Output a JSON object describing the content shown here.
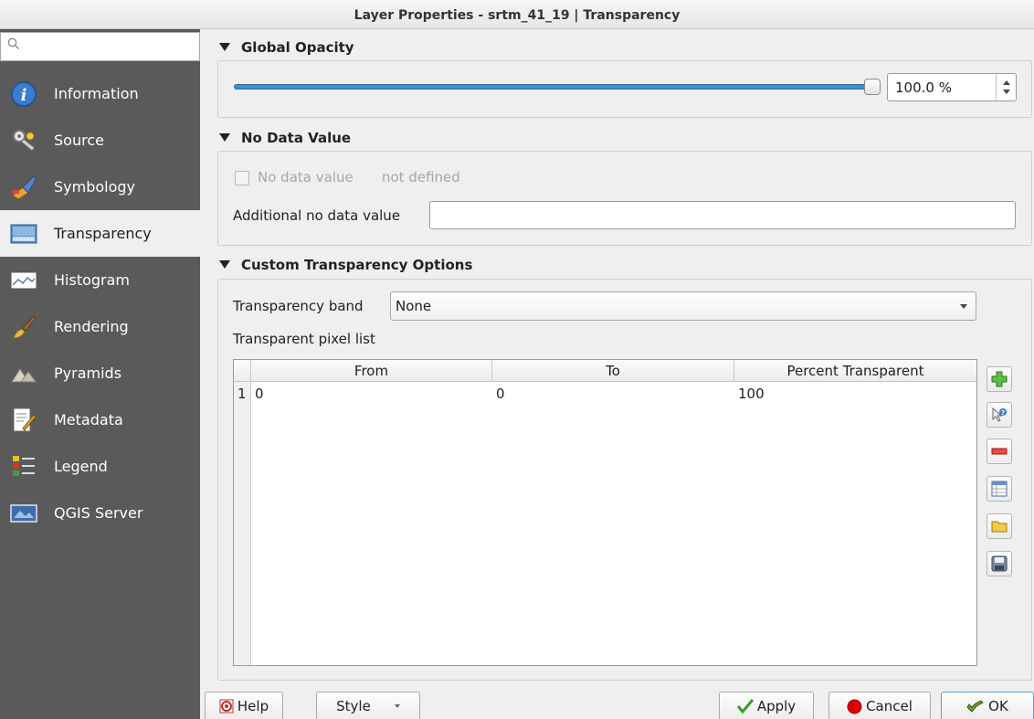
{
  "window": {
    "title": "Layer Properties - srtm_41_19 | Transparency"
  },
  "sidebar": {
    "search_placeholder": "",
    "items": [
      {
        "label": "Information",
        "icon": "information-icon"
      },
      {
        "label": "Source",
        "icon": "source-icon"
      },
      {
        "label": "Symbology",
        "icon": "symbology-icon"
      },
      {
        "label": "Transparency",
        "icon": "transparency-icon",
        "active": true
      },
      {
        "label": "Histogram",
        "icon": "histogram-icon"
      },
      {
        "label": "Rendering",
        "icon": "rendering-icon"
      },
      {
        "label": "Pyramids",
        "icon": "pyramids-icon"
      },
      {
        "label": "Metadata",
        "icon": "metadata-icon"
      },
      {
        "label": "Legend",
        "icon": "legend-icon"
      },
      {
        "label": "QGIS Server",
        "icon": "qgis-server-icon"
      }
    ]
  },
  "global_opacity": {
    "title": "Global Opacity",
    "value": 1.0,
    "spin_text": "100.0 %"
  },
  "no_data": {
    "title": "No Data Value",
    "checkbox_label": "No data value",
    "checkbox_checked": false,
    "status": "not defined",
    "additional_label": "Additional no data value",
    "additional_value": ""
  },
  "custom_transparency": {
    "title": "Custom Transparency Options",
    "band_label": "Transparency band",
    "band_value": "None",
    "pixel_list_label": "Transparent pixel list",
    "columns": [
      "From",
      "To",
      "Percent Transparent"
    ],
    "rows": [
      {
        "num": "1",
        "from": "0",
        "to": "0",
        "percent": "100"
      }
    ],
    "side_buttons": [
      "add-icon",
      "add-from-display-icon",
      "remove-icon",
      "default-values-icon",
      "import-icon",
      "save-icon"
    ]
  },
  "buttons": {
    "help": "Help",
    "style": "Style",
    "apply": "Apply",
    "cancel": "Cancel",
    "ok": "OK"
  },
  "colors": {
    "sidebar_bg": "#5a5a5a",
    "slider_fill": "#3d93d0",
    "cancel_red": "#e00000"
  }
}
